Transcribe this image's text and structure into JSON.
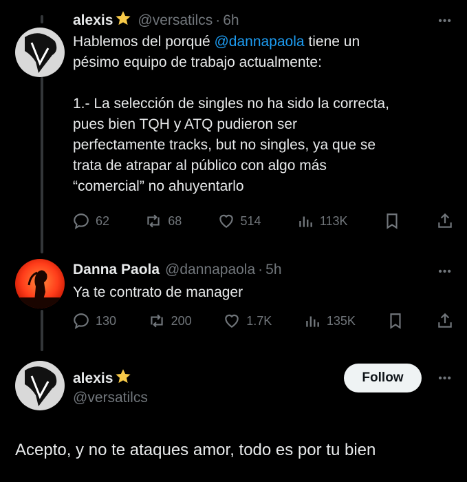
{
  "tweet1": {
    "name": "alexis",
    "handle": "@versatilcs",
    "separator": "·",
    "time": "6h",
    "text_before": "Hablemos del porqué ",
    "mention": "@dannapaola",
    "text_after": " tiene un\npésimo equipo de trabajo actualmente:\n\n1.- La selección de singles no ha sido la correcta,\npues bien TQH y ATQ pudieron ser\nperfectamente tracks, but no singles, ya que se\ntrata de atrapar al público con algo más\n“comercial” no ahuyentarlo",
    "replies": "62",
    "retweets": "68",
    "likes": "514",
    "views": "113K",
    "more": "•••"
  },
  "tweet2": {
    "name": "Danna Paola",
    "handle": "@dannapaola",
    "separator": "·",
    "time": "5h",
    "text": "Ya te contrato de manager",
    "replies": "130",
    "retweets": "200",
    "likes": "1.7K",
    "views": "135K",
    "more": "•••"
  },
  "tweet3": {
    "name": "alexis",
    "handle": "@versatilcs",
    "follow_label": "Follow",
    "text": "Acepto, y no te ataques amor, todo es por tu bien",
    "more": "•••"
  },
  "icons": [
    "reply-icon",
    "retweet-icon",
    "like-icon",
    "views-icon",
    "bookmark-icon",
    "share-icon",
    "star-icon"
  ],
  "colors": {
    "background": "#000000",
    "text": "#e7e9ea",
    "muted": "#71767b",
    "mention": "#1d9bf0",
    "follow_bg": "#eff3f4",
    "star": "#f7c948"
  }
}
